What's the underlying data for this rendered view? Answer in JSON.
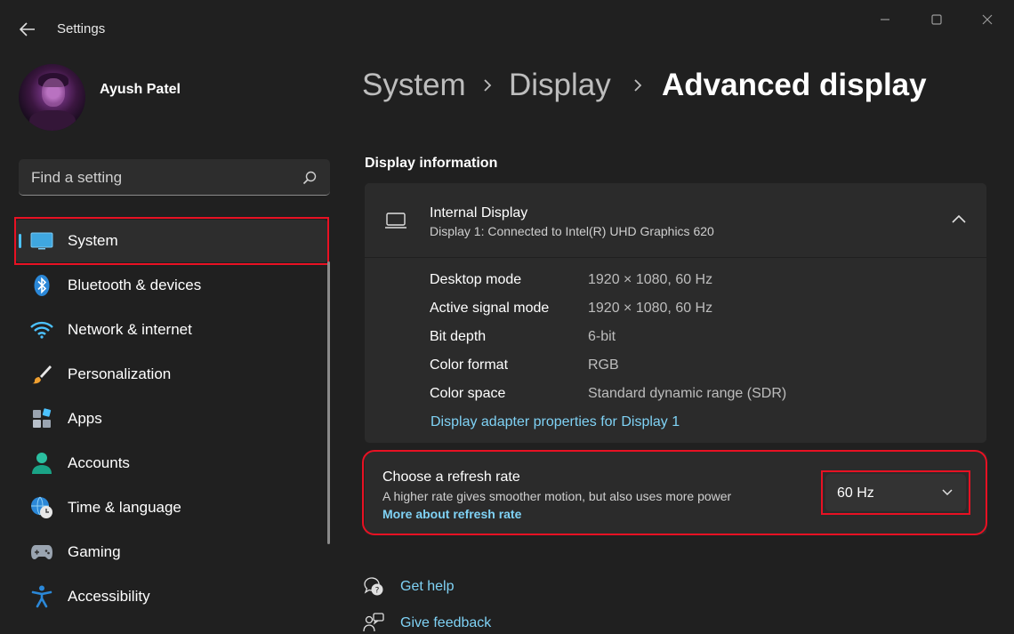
{
  "window": {
    "title": "Settings",
    "controls": [
      "minimize-icon",
      "maximize-icon",
      "close-icon"
    ]
  },
  "profile": {
    "name": "Ayush Patel"
  },
  "search": {
    "placeholder": "Find a setting"
  },
  "sidebar": {
    "items": [
      {
        "label": "System",
        "icon": "system-icon",
        "selected": true
      },
      {
        "label": "Bluetooth & devices",
        "icon": "bluetooth-icon"
      },
      {
        "label": "Network & internet",
        "icon": "wifi-icon"
      },
      {
        "label": "Personalization",
        "icon": "paintbrush-icon"
      },
      {
        "label": "Apps",
        "icon": "apps-icon"
      },
      {
        "label": "Accounts",
        "icon": "accounts-icon"
      },
      {
        "label": "Time & language",
        "icon": "time-language-icon"
      },
      {
        "label": "Gaming",
        "icon": "gamepad-icon"
      },
      {
        "label": "Accessibility",
        "icon": "accessibility-icon"
      }
    ]
  },
  "breadcrumb": {
    "items": [
      "System",
      "Display",
      "Advanced display"
    ]
  },
  "display_info": {
    "section_title": "Display information",
    "display_name": "Internal Display",
    "display_subtitle": "Display 1: Connected to Intel(R) UHD Graphics 620",
    "rows": [
      {
        "label": "Desktop mode",
        "value": "1920 × 1080, 60 Hz"
      },
      {
        "label": "Active signal mode",
        "value": "1920 × 1080, 60 Hz"
      },
      {
        "label": "Bit depth",
        "value": "6-bit"
      },
      {
        "label": "Color format",
        "value": "RGB"
      },
      {
        "label": "Color space",
        "value": "Standard dynamic range (SDR)"
      }
    ],
    "adapter_link": "Display adapter properties for Display 1"
  },
  "refresh_rate": {
    "title": "Choose a refresh rate",
    "description": "A higher rate gives smoother motion, but also uses more power",
    "link": "More about refresh rate",
    "selected_value": "60 Hz"
  },
  "footer": {
    "help": "Get help",
    "feedback": "Give feedback"
  },
  "colors": {
    "background": "#202020",
    "card": "#2b2b2b",
    "accent": "#4cc2ff",
    "link": "#7fd2f5",
    "highlight_annotation": "#e81123"
  }
}
